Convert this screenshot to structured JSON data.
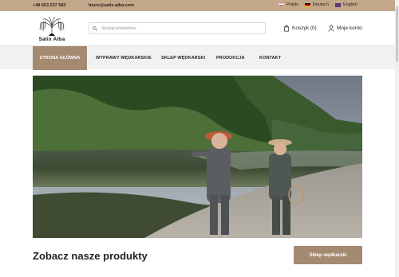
{
  "topbar": {
    "phone": "+48 603 237 583",
    "email": "biuro@salix-alba.com",
    "languages": [
      {
        "label": "Polski",
        "flag": "pl"
      },
      {
        "label": "Deutsch",
        "flag": "de"
      },
      {
        "label": "English",
        "flag": "en"
      }
    ]
  },
  "header": {
    "logo_text": "Salix Alba",
    "search_placeholder": "Szukaj produktów",
    "cart_label": "Koszyk (0)",
    "account_label": "Moje konto"
  },
  "nav": {
    "items": [
      {
        "label": "STRONA GŁÓWNA",
        "active": true
      },
      {
        "label": "WYPRAWY WĘDKARSKIE"
      },
      {
        "label": "SKLEP WĘDKARSKI"
      },
      {
        "label": "PRODUKCJA"
      },
      {
        "label": "KONTAKT"
      }
    ]
  },
  "main": {
    "section_title": "Zobacz nasze produkty",
    "cta_label": "Sklep wędkarski"
  },
  "colors": {
    "topbar": "#c2a889",
    "accent": "#a58a72",
    "nav_bg": "#f1f1f1"
  }
}
